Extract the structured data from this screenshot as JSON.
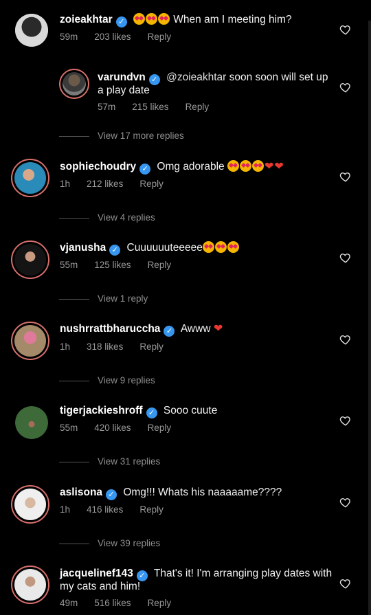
{
  "comments": [
    {
      "user": "zoieakhtar",
      "text": "When am I meeting him?",
      "emojis_before": 3,
      "hearts": 0,
      "time": "59m",
      "likes": "203 likes",
      "reply": "Reply"
    },
    {
      "user": "varundvn",
      "mention": "@zoieakhtar",
      "text": " soon soon will set up",
      "text2": "a play date",
      "time": "57m",
      "likes": "215 likes",
      "reply": "Reply"
    },
    {
      "user": "sophiechoudry",
      "text": "Omg adorable",
      "time": "1h",
      "likes": "212 likes",
      "reply": "Reply"
    },
    {
      "user": "vjanusha",
      "text": "Cuuuuuuteeeee",
      "time": "55m",
      "likes": "125 likes",
      "reply": "Reply"
    },
    {
      "user": "nushrrattbharuccha",
      "text": "Awww",
      "time": "1h",
      "likes": "318 likes",
      "reply": "Reply"
    },
    {
      "user": "tigerjackieshroff",
      "text": "Sooo cuute",
      "time": "55m",
      "likes": "420 likes",
      "reply": "Reply"
    },
    {
      "user": "aslisona",
      "text": "Omg!!! Whats his naaaaame????",
      "time": "1h",
      "likes": "416 likes",
      "reply": "Reply"
    },
    {
      "user": "jacquelinef143",
      "text": "That's it! I'm arranging play dates with",
      "text2": "my cats and him!",
      "time": "49m",
      "likes": "516 likes",
      "reply": "Reply"
    }
  ],
  "view_replies": [
    "View 17 more replies",
    "View 4 replies",
    "View 1 reply",
    "View 9 replies",
    "View 31 replies",
    "View 39 replies"
  ],
  "icons": {
    "verified": "verified-badge-icon",
    "like": "heart-outline-icon"
  },
  "colors": {
    "background": "#000000",
    "verified": "#3797f0",
    "story_ring": "#d7706b",
    "secondary_text": "#9a9a9a"
  }
}
